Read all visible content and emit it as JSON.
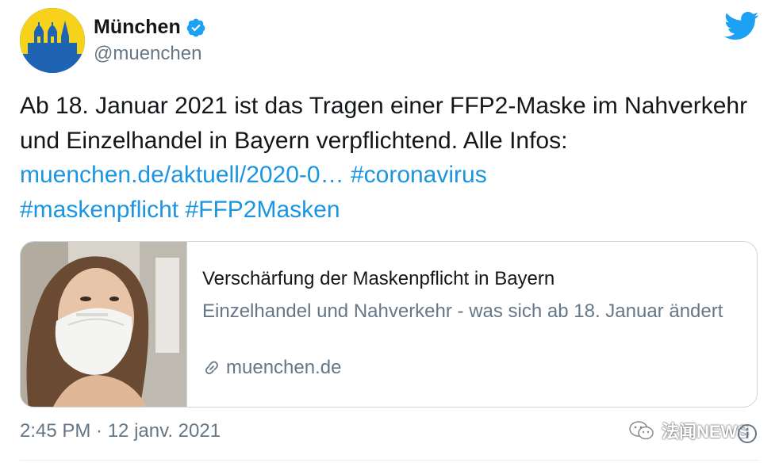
{
  "author": {
    "display_name": "München",
    "handle": "@muenchen",
    "verified": true,
    "avatar_icon": "munich-frauenkirche-logo"
  },
  "brand": {
    "twitter_blue": "#1da1f2",
    "link_color": "#1b95e0"
  },
  "tweet": {
    "text_line_1": "Ab 18. Januar 2021 ist das Tragen einer FFP2-Maske im Nahverkehr und Einzelhandel in Bayern verpflichtend. Alle Infos:",
    "link": "muenchen.de/aktuell/2020-0…",
    "hashtags": [
      "#coronavirus",
      "#maskenpflicht",
      "#FFP2Masken"
    ]
  },
  "card": {
    "title": "Verschärfung der Maskenpflicht in Bayern",
    "description": "Einzelhandel und Nahverkehr - was sich ab 18. Januar ändert",
    "domain": "muenchen.de",
    "image_icon": "woman-wearing-ffp2-mask-photo"
  },
  "meta": {
    "timestamp": "2:45 PM · 12 janv. 2021"
  },
  "watermark": {
    "text": "法闻NEWS"
  }
}
